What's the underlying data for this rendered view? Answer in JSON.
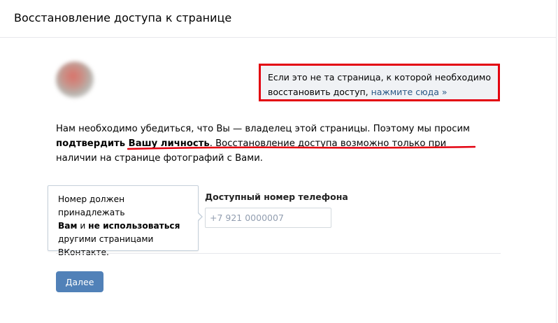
{
  "header": {
    "title": "Восстановление доступа к странице"
  },
  "notice": {
    "text": "Если это не та страница, к которой необходимо восстановить доступ,",
    "link": "нажмите сюда »"
  },
  "intro": {
    "part1": "Нам необходимо убедиться, что Вы — владелец этой страницы. Поэтому мы просим ",
    "bold": "подтвердить Вашу личность",
    "part2": ". ",
    "underlined": "Восстановление доступа возможно только при наличии на странице фотографий",
    "part3": " с Вами."
  },
  "tooltip": {
    "line1": "Номер должен принадлежать",
    "bold1": "Вам",
    "mid": " и ",
    "bold2": "не использоваться",
    "line3": "другими страницами ВКонтакте."
  },
  "phone": {
    "label": "Доступный номер телефона",
    "placeholder": "+7 921 0000007",
    "value": ""
  },
  "actions": {
    "next_label": "Далее"
  },
  "colors": {
    "accent": "#5181b8",
    "link": "#2a5885",
    "highlight_border": "#e3000f",
    "underline_mark": "#e3000f"
  }
}
